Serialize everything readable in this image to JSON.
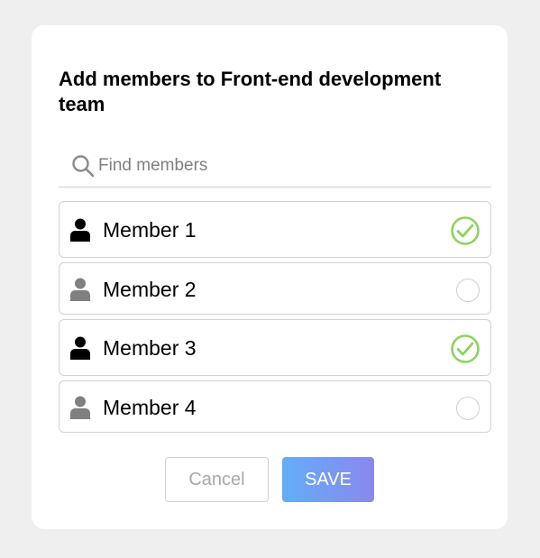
{
  "dialog": {
    "title": "Add members to Front-end development team",
    "search": {
      "placeholder": "Find members",
      "value": ""
    },
    "members": [
      {
        "name": "Member 1",
        "selected": true
      },
      {
        "name": "Member 2",
        "selected": false
      },
      {
        "name": "Member 3",
        "selected": true
      },
      {
        "name": "Member 4",
        "selected": false
      }
    ],
    "buttons": {
      "cancel_label": "Cancel",
      "save_label": "SAVE"
    }
  },
  "icons": {
    "search": "search-icon",
    "person": "person-icon",
    "check": "check-circle-icon",
    "radio": "radio-circle-icon"
  },
  "colors": {
    "selected_person": "#000000",
    "unselected_person": "#808080",
    "check_green": "#8fd163",
    "save_gradient_start": "#63aef7",
    "save_gradient_end": "#8a87ee"
  }
}
